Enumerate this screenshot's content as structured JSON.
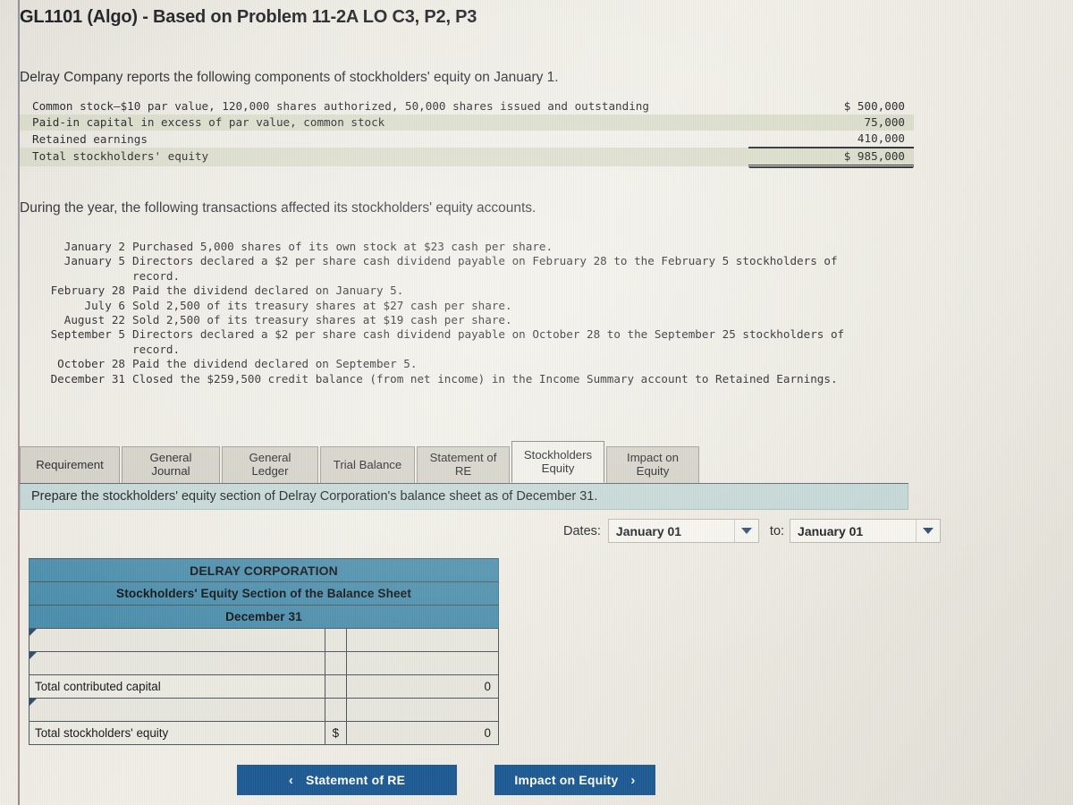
{
  "title": "GL1101 (Algo) - Based on Problem 11-2A LO C3, P2, P3",
  "intro": "Delray Company reports the following components of stockholders' equity on January 1.",
  "during_text": "During the year, the following transactions affected its stockholders' equity accounts.",
  "equity_table": {
    "rows": [
      {
        "label": "Common stock—$10 par value, 120,000 shares authorized, 50,000 shares issued and outstanding",
        "amount": "$ 500,000"
      },
      {
        "label": "Paid-in capital in excess of par value, common stock",
        "amount": "75,000"
      },
      {
        "label": "Retained earnings",
        "amount": "410,000"
      },
      {
        "label": "Total stockholders' equity",
        "amount": "$ 985,000"
      }
    ]
  },
  "transactions": [
    {
      "date": "January 2",
      "text": "Purchased 5,000 shares of its own stock at $23 cash per share.",
      "cont": ""
    },
    {
      "date": "January 5",
      "text": "Directors declared a $2 per share cash dividend payable on February 28 to the February 5 stockholders of",
      "cont": "record."
    },
    {
      "date": "February 28",
      "text": "Paid the dividend declared on January 5.",
      "cont": ""
    },
    {
      "date": "July 6",
      "text": "Sold 2,500 of its treasury shares at $27 cash per share.",
      "cont": ""
    },
    {
      "date": "August 22",
      "text": "Sold 2,500 of its treasury shares at $19 cash per share.",
      "cont": ""
    },
    {
      "date": "September 5",
      "text": "Directors declared a $2 per share cash dividend payable on October 28 to the September 25 stockholders of",
      "cont": "record."
    },
    {
      "date": "October 28",
      "text": "Paid the dividend declared on September 5.",
      "cont": ""
    },
    {
      "date": "December 31",
      "text": "Closed the $259,500 credit balance (from net income) in the Income Summary account to Retained Earnings.",
      "cont": ""
    }
  ],
  "tabs": [
    {
      "label": "Requirement",
      "active": false
    },
    {
      "label": "General\nJournal",
      "line1": "General",
      "line2": "Journal",
      "active": false
    },
    {
      "label": "General\nLedger",
      "line1": "General",
      "line2": "Ledger",
      "active": false
    },
    {
      "label": "Trial Balance",
      "line1": "Trial Balance",
      "line2": "",
      "active": false
    },
    {
      "label": "Statement of\nRE",
      "line1": "Statement of",
      "line2": "RE",
      "active": false
    },
    {
      "label": "Stockholders\nEquity",
      "line1": "Stockholders",
      "line2": "Equity",
      "active": true
    },
    {
      "label": "Impact on\nEquity",
      "line1": "Impact on",
      "line2": "Equity",
      "active": false
    }
  ],
  "requirement_text": "Prepare the stockholders' equity section of Delray Corporation's balance sheet as of December 31.",
  "dates": {
    "label": "Dates:",
    "from_value": "January 01",
    "to_label": "to:",
    "to_value": "January 01"
  },
  "sheet": {
    "header_line1": "DELRAY CORPORATION",
    "header_line2": "Stockholders' Equity Section of the Balance Sheet",
    "header_line3": "December 31",
    "rows": [
      {
        "label": "",
        "sym": "",
        "value": ""
      },
      {
        "label": "",
        "sym": "",
        "value": ""
      },
      {
        "label": "Total contributed capital",
        "sym": "",
        "value": "0"
      },
      {
        "label": "",
        "sym": "",
        "value": ""
      },
      {
        "label": "Total stockholders' equity",
        "sym": "$",
        "value": "0"
      }
    ]
  },
  "nav": {
    "prev_label": "Statement of RE",
    "prev_chevron": "‹",
    "next_label": "Impact on Equity",
    "next_chevron": "›"
  },
  "colors": {
    "sheet_header_blue": "#4b8fad",
    "button_blue": "#1d5b94",
    "requirement_band": "#c3d7d6",
    "tab_inactive": "#d3d1c6",
    "tab_active": "#f2f1ea"
  }
}
